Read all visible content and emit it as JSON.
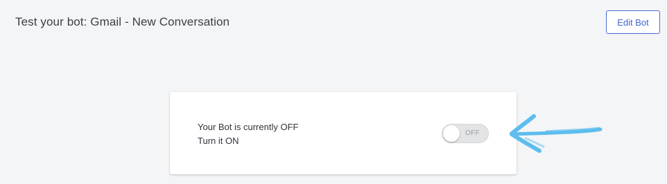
{
  "header": {
    "title": "Test your bot: Gmail - New Conversation",
    "edit_label": "Edit Bot"
  },
  "card": {
    "status_line": "Your Bot is currently OFF",
    "action_line": "Turn it ON",
    "toggle": {
      "state": "off",
      "label": "OFF"
    }
  },
  "colors": {
    "accent": "#4c6fd1",
    "annotation_arrow": "#4db8ee"
  },
  "icons": {
    "annotation": "hand-drawn-arrow-icon"
  }
}
